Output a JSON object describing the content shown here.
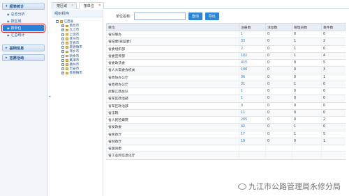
{
  "sidebar": {
    "sections": [
      {
        "title": "报表统计",
        "items": [
          {
            "label": "总览分析",
            "active": false
          },
          {
            "label": "按区域",
            "active": false
          },
          {
            "label": "按单位",
            "active": true
          },
          {
            "label": "汇总统计",
            "active": false
          }
        ]
      },
      {
        "title": "基础信息",
        "items": []
      },
      {
        "title": "志愿活动",
        "items": []
      }
    ]
  },
  "tabs": [
    {
      "label": "按区域",
      "active": false
    },
    {
      "label": "按单位",
      "active": true
    }
  ],
  "tree": {
    "title": "组织机构",
    "root": "江西省",
    "children": [
      "南昌市",
      "九江市",
      "上饶市",
      "抚州市",
      "宜春市",
      "景德镇市",
      "萍乡市",
      "新余市",
      "鹰潭市",
      "赣州市",
      "吉安市",
      "景德镇市"
    ]
  },
  "toolbar": {
    "unit_label": "单位名称:",
    "search_button": "查询",
    "export_button": "导出",
    "input_value": "",
    "input_placeholder": ""
  },
  "table": {
    "columns": [
      "单位",
      "注册数",
      "活动数",
      "管理员数",
      "事件数"
    ],
    "rows": [
      [
        "省妇联办",
        "1",
        "0",
        "0",
        "0"
      ],
      [
        "省纪委(省监委)",
        "33",
        "0",
        "1",
        "2"
      ],
      [
        "省委组织部",
        "2",
        "0",
        "1",
        "0"
      ],
      [
        "省委宣传部",
        "102",
        "0",
        "1",
        "4"
      ],
      [
        "省委政法委",
        "415",
        "0",
        "0",
        "5"
      ],
      [
        "省人大常委会机关",
        "100",
        "0",
        "0",
        "3"
      ],
      [
        "省政协办公厅",
        "36",
        "0",
        "0",
        "1"
      ],
      [
        "省政府办公厅",
        "31",
        "0",
        "1",
        "0"
      ],
      [
        "武警江西总队",
        "1",
        "0",
        "0",
        "0"
      ],
      [
        "省军区政治部",
        "1",
        "0",
        "0",
        "0"
      ],
      [
        "省军区政治部",
        "0",
        "0",
        "0",
        "0"
      ],
      [
        "省法院",
        "11",
        "0",
        "0",
        "0"
      ],
      [
        "省人民检察院",
        "205",
        "0",
        "0",
        "2"
      ],
      [
        "省发改委",
        "42",
        "0",
        "1",
        "0"
      ],
      [
        "省民政厅",
        "17",
        "0",
        "1",
        "5"
      ],
      [
        "省财政厅",
        "19",
        "0",
        "0",
        "1"
      ],
      [
        "省国资委",
        "",
        "",
        "",
        ""
      ],
      [
        "省工业和信息化厅",
        "",
        "",
        "",
        ""
      ]
    ]
  },
  "watermark": "九江市公路管理局永修分局"
}
